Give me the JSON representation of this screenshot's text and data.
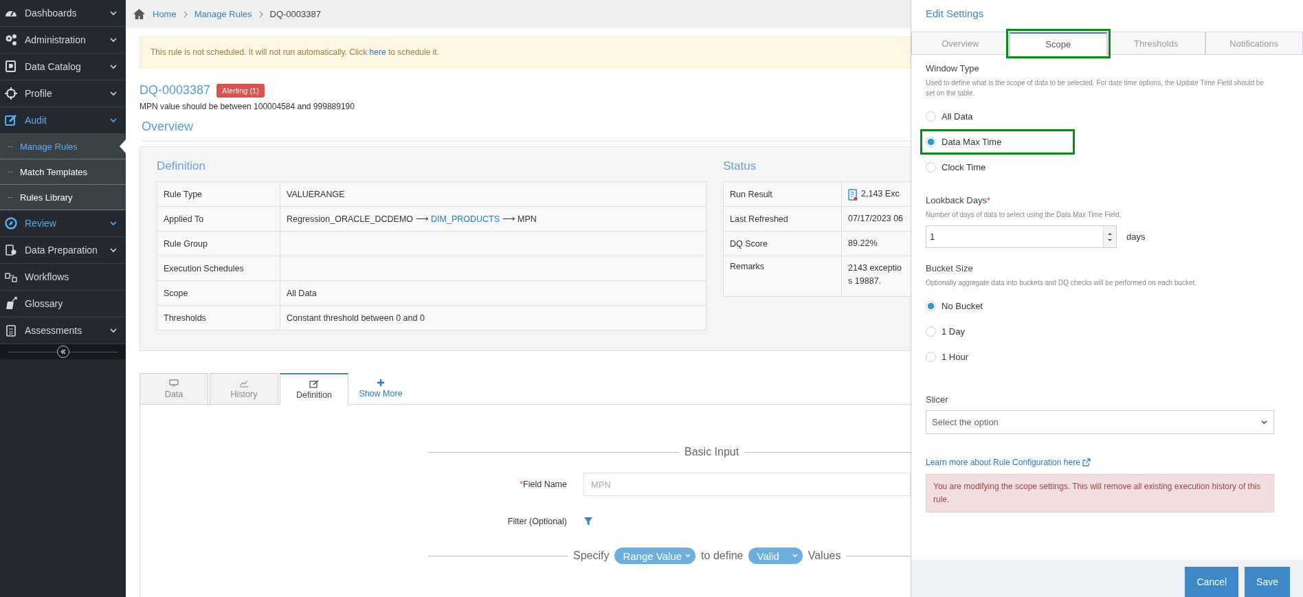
{
  "sidebar": {
    "items": [
      {
        "label": "Dashboards",
        "expandable": true,
        "active": false,
        "expanded": false
      },
      {
        "label": "Administration",
        "expandable": true,
        "active": false,
        "expanded": false
      },
      {
        "label": "Data Catalog",
        "expandable": true,
        "active": false,
        "expanded": false
      },
      {
        "label": "Profile",
        "expandable": true,
        "active": false,
        "expanded": false
      },
      {
        "label": "Audit",
        "expandable": true,
        "active": true,
        "expanded": true,
        "children": [
          {
            "label": "Manage Rules",
            "selected": true
          },
          {
            "label": "Match Templates",
            "selected": false
          },
          {
            "label": "Rules Library",
            "selected": false
          }
        ]
      },
      {
        "label": "Review",
        "expandable": true,
        "active": true,
        "expanded": false
      },
      {
        "label": "Data Preparation",
        "expandable": true,
        "active": false,
        "expanded": false
      },
      {
        "label": "Workflows",
        "expandable": false,
        "active": false
      },
      {
        "label": "Glossary",
        "expandable": false,
        "active": false
      },
      {
        "label": "Assessments",
        "expandable": true,
        "active": false,
        "expanded": false
      }
    ]
  },
  "breadcrumb": [
    {
      "label": "Home",
      "current": false
    },
    {
      "label": "Manage Rules",
      "current": false
    },
    {
      "label": "DQ-0003387",
      "current": true
    }
  ],
  "notice": {
    "before": "This rule is not scheduled. It will not run automatically. Click ",
    "link": "here",
    "after": " to schedule it."
  },
  "rule": {
    "id": "DQ-0003387",
    "badge": "Alerting (1)",
    "description": "MPN value should be between 100004584 and 999889190"
  },
  "overview": {
    "title": "Overview",
    "definition": {
      "title": "Definition",
      "rows": [
        {
          "label": "Rule Type",
          "value": "VALUERANGE"
        },
        {
          "label": "Applied To",
          "separator": "⟶",
          "source": "Regression_ORACLE_DCDEMO",
          "link": "DIM_PRODUCTS",
          "column": "MPN"
        },
        {
          "label": "Rule Group"
        },
        {
          "label": "Execution Schedules"
        },
        {
          "label": "Scope",
          "value": "All Data"
        },
        {
          "label": "Thresholds",
          "value": "Constant threshold between 0 and 0"
        }
      ]
    },
    "status": {
      "title": "Status",
      "rows": [
        {
          "label": "Run Result",
          "kind": "result",
          "lines": [
            "2,143 Exc"
          ]
        },
        {
          "label": "Last Refreshed",
          "kind": "text",
          "lines": [
            "07/17/2023 06"
          ]
        },
        {
          "label": "DQ Score",
          "kind": "text",
          "lines": [
            "89.22%"
          ]
        },
        {
          "label": "Remarks",
          "kind": "text",
          "lines": [
            "2143 exceptio",
            "s 19887."
          ]
        }
      ]
    }
  },
  "detail_tabs": [
    {
      "label": "Data",
      "selected": false
    },
    {
      "label": "History",
      "selected": false
    },
    {
      "label": "Definition",
      "selected": true
    }
  ],
  "show_more": "Show More",
  "form": {
    "legend": "Basic Input",
    "field": {
      "label": "Field Name",
      "required_mark": "*",
      "placeholder": "MPN"
    },
    "filter_label": "Filter (Optional)",
    "specify": {
      "before": "Specify",
      "range": "Range Value",
      "middle": "to define",
      "validity": "Valid",
      "after": "Values"
    }
  },
  "panel": {
    "title": "Edit Settings",
    "tabs": [
      {
        "label": "Overview",
        "selected": false,
        "highlighted": false
      },
      {
        "label": "Scope",
        "selected": true,
        "highlighted": true
      },
      {
        "label": "Thresholds",
        "selected": false,
        "highlighted": false
      },
      {
        "label": "Notifications",
        "selected": false,
        "highlighted": false
      }
    ],
    "window_type": {
      "label": "Window Type",
      "description": "Used to define what is the scope of data to be selected. For date time options, the Update Time Field should be set on the table.",
      "options": [
        {
          "label": "All Data",
          "selected": false,
          "highlighted": false
        },
        {
          "label": "Data Max Time",
          "selected": true,
          "highlighted": true
        },
        {
          "label": "Clock Time",
          "selected": false,
          "highlighted": false
        }
      ]
    },
    "lookback": {
      "label": "Lookback Days",
      "required_mark": "*",
      "description": "Number of days of data to select using the Data Max Time Field.",
      "value": "1",
      "unit": "days"
    },
    "bucket": {
      "label": "Bucket Size",
      "description": "Optionally aggregate data into buckets and DQ checks will be performed on each bucket.",
      "options": [
        {
          "label": "No Bucket",
          "selected": true,
          "highlighted": false
        },
        {
          "label": "1 Day",
          "selected": false,
          "highlighted": false
        },
        {
          "label": "1 Hour",
          "selected": false,
          "highlighted": false
        }
      ]
    },
    "slicer": {
      "label": "Slicer",
      "placeholder": "Select the option"
    },
    "link": "Learn more about Rule Configuration here",
    "warning": "You are modifying the scope settings. This will remove all existing execution history of this rule.",
    "buttons": [
      "Cancel",
      "Save"
    ]
  }
}
